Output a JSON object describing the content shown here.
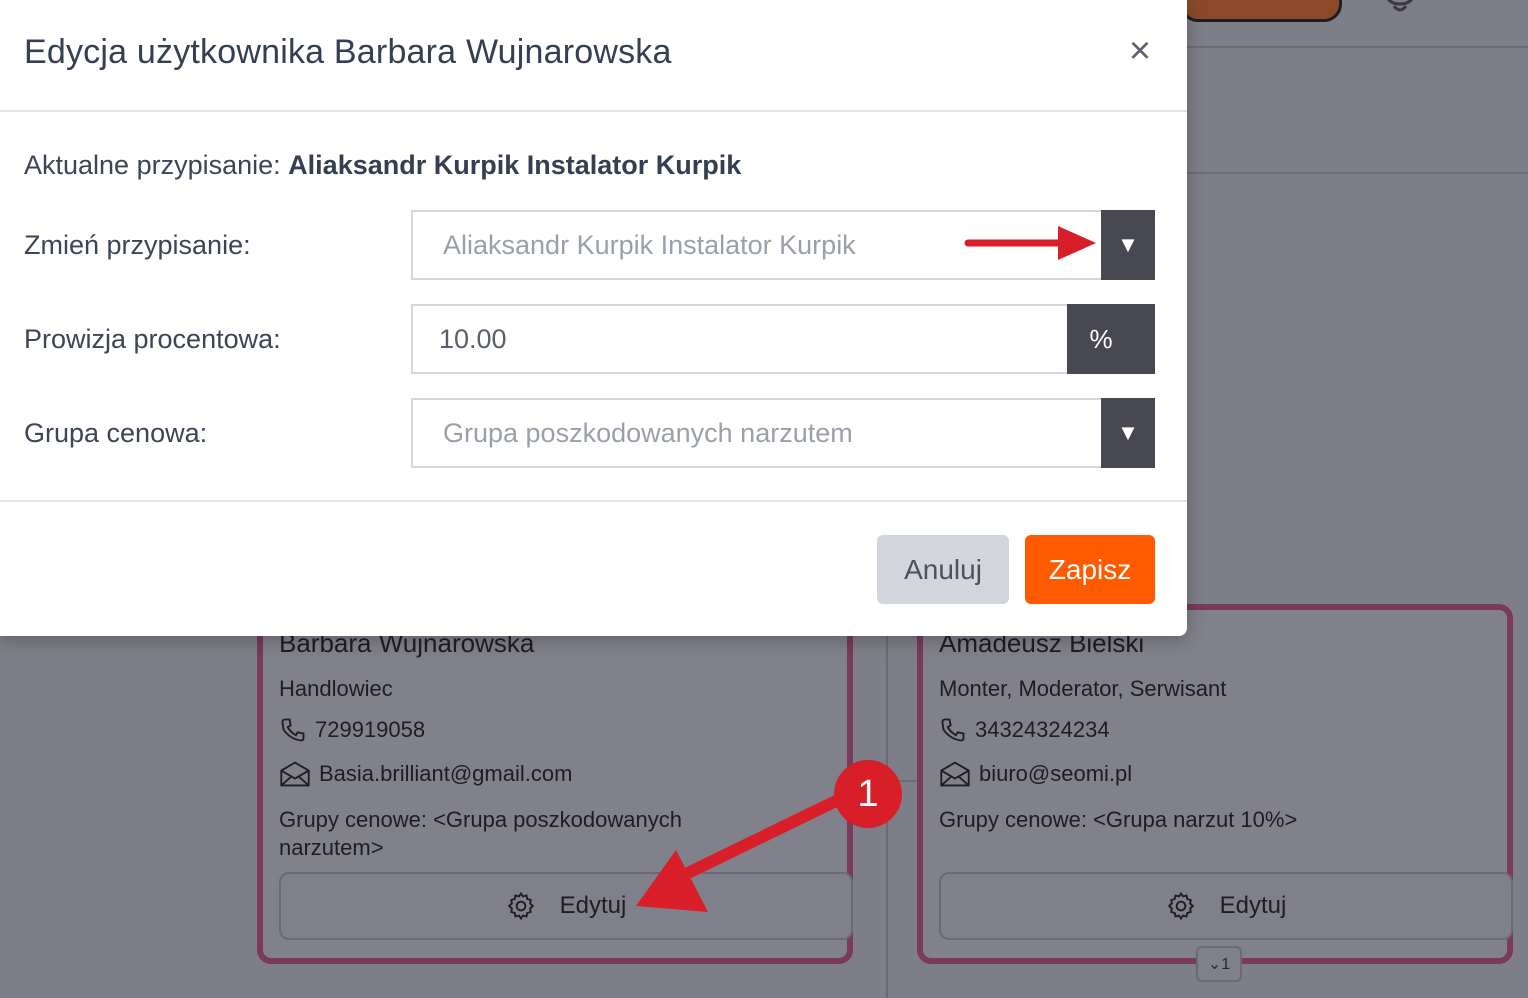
{
  "modal": {
    "title": "Edycja użytkownika Barbara Wujnarowska",
    "close_symbol": "×",
    "current_label": "Aktualne przypisanie:",
    "current_value": "Aliaksandr Kurpik Instalator Kurpik",
    "assign_label": "Zmień przypisanie:",
    "assign_value": "Aliaksandr Kurpik Instalator Kurpik",
    "commission_label": "Prowizja procentowa:",
    "commission_value": "10.00",
    "commission_unit": "%",
    "group_label": "Grupa cenowa:",
    "group_value": "Grupa poszkodowanych narzutem",
    "cancel_label": "Anuluj",
    "save_label": "Zapisz",
    "dropdown_symbol": "▼"
  },
  "cards": [
    {
      "name": "Barbara Wujnarowska",
      "role": "Handlowiec",
      "phone": "729919058",
      "email": "Basia.brilliant@gmail.com",
      "groups": "Grupy cenowe: <Grupa poszkodowanych narzutem>",
      "edit_label": "Edytuj"
    },
    {
      "name": "Amadeusz Bielski",
      "role": "Monter, Moderator, Serwisant",
      "phone": "34324324234",
      "email": "biuro@seomi.pl",
      "groups": "Grupy cenowe: <Grupa narzut 10%>",
      "edit_label": "Edytuj"
    }
  ],
  "collapse_badge": "⌄1",
  "annotation": {
    "step_number": "1",
    "color": "#d81e28"
  },
  "colors": {
    "accent": "#ff5a00",
    "dark_addon": "#474852",
    "card_border": "#7a3a5a"
  }
}
